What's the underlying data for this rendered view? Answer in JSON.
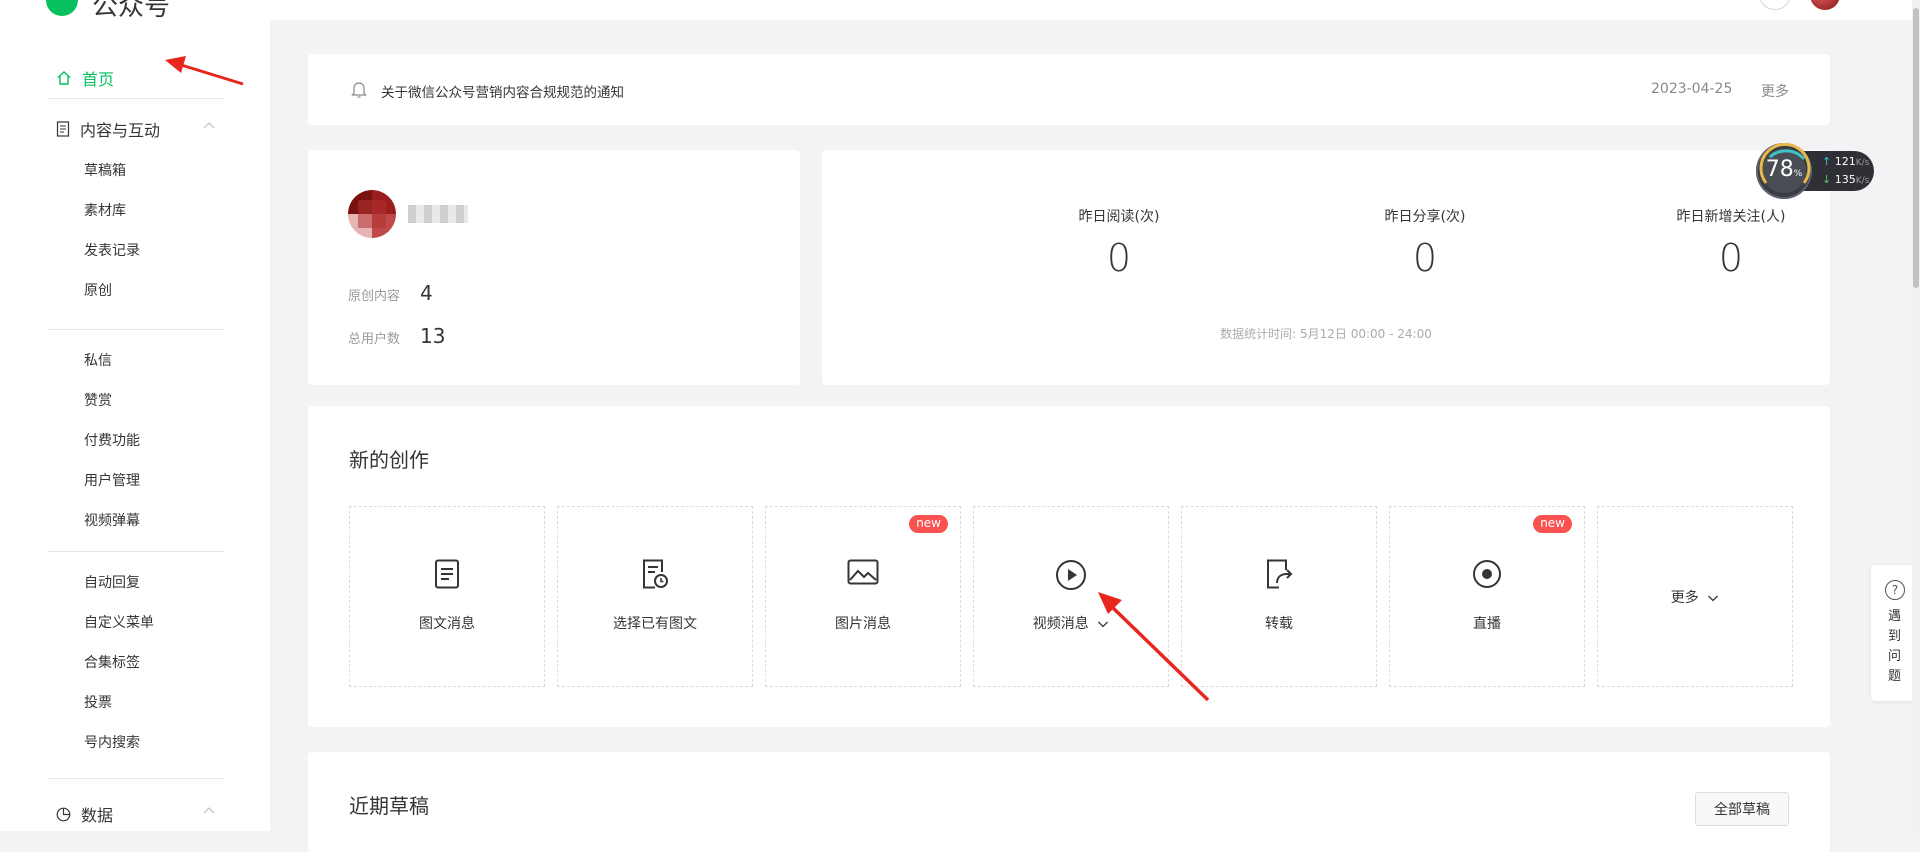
{
  "topbar": {
    "brand": "公众号"
  },
  "sidebar": {
    "home": "首页",
    "content_section": "内容与互动",
    "content_items_1": [
      "草稿箱",
      "素材库",
      "发表记录",
      "原创"
    ],
    "content_items_2": [
      "私信",
      "赞赏",
      "付费功能",
      "用户管理",
      "视频弹幕"
    ],
    "content_items_3": [
      "自动回复",
      "自定义菜单",
      "合集标签",
      "投票",
      "号内搜索"
    ],
    "data_section": "数据"
  },
  "notice": {
    "text": "关于微信公众号营销内容合规规范的通知",
    "date": "2023-04-25",
    "more": "更多"
  },
  "profile": {
    "original_label": "原创内容",
    "original_value": "4",
    "users_label": "总用户数",
    "users_value": "13"
  },
  "yesterday": {
    "reads_label": "昨日阅读(次)",
    "reads_value": "0",
    "shares_label": "昨日分享(次)",
    "shares_value": "0",
    "follows_label": "昨日新增关注(人)",
    "follows_value": "0",
    "note": "数据统计时间: 5月12日 00:00 - 24:00"
  },
  "create": {
    "title": "新的创作",
    "tiles": [
      {
        "label": "图文消息",
        "icon": "doc-icon"
      },
      {
        "label": "选择已有图文",
        "icon": "doc-clock-icon"
      },
      {
        "label": "图片消息",
        "icon": "image-icon",
        "badge": "new"
      },
      {
        "label": "视频消息",
        "icon": "play-icon"
      },
      {
        "label": "转载",
        "icon": "share-icon"
      },
      {
        "label": "直播",
        "icon": "live-icon",
        "badge": "new"
      }
    ],
    "more": "更多"
  },
  "drafts": {
    "title": "近期草稿",
    "all_button": "全部草稿"
  },
  "net_widget": {
    "percent": "78",
    "percent_unit": "%",
    "up": "121",
    "down": "135",
    "unit": "K/s"
  },
  "help": {
    "text": "遇到问题"
  },
  "colors": {
    "accent": "#07c160",
    "badge": "#fa5151",
    "annotation_arrow": "#e8261e"
  }
}
